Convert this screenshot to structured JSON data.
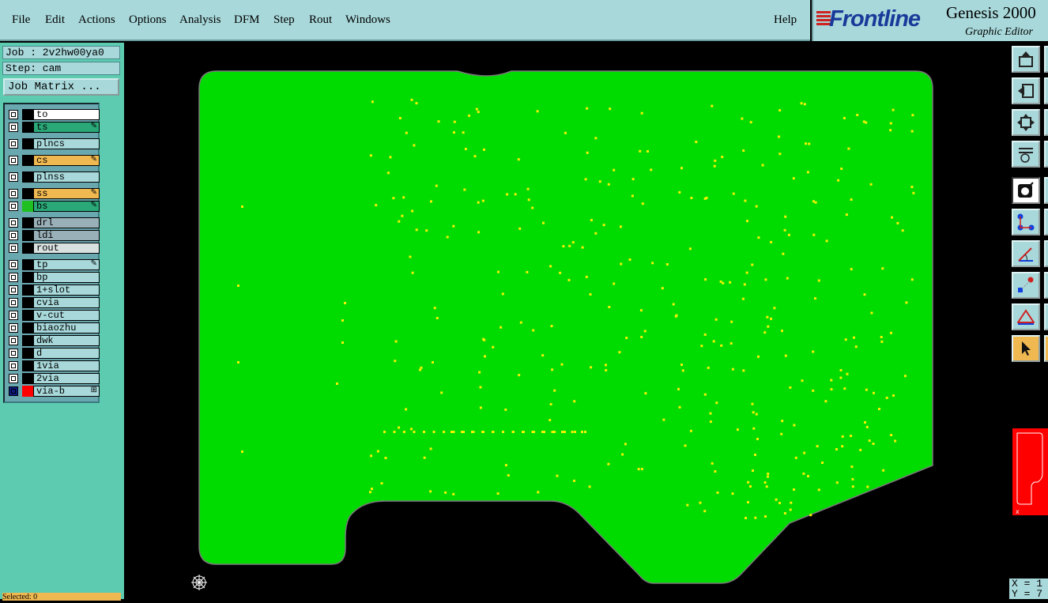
{
  "menubar": {
    "items": [
      "File",
      "Edit",
      "Actions",
      "Options",
      "Analysis",
      "DFM",
      "Step",
      "Rout",
      "Windows"
    ],
    "help": "Help"
  },
  "brand": {
    "logo_text": "Frontline",
    "product": "Genesis 2000",
    "subtitle": "Graphic Editor"
  },
  "job": {
    "job_line": "Job : 2v2hw00ya0",
    "step_line": "Step: cam",
    "matrix_button": "Job Matrix ..."
  },
  "layers": [
    {
      "name": "to",
      "color": "#ffffff"
    },
    {
      "name": "ts",
      "color": "#2aa878",
      "flag": true
    },
    {
      "name": "plncs",
      "color": "#a8d8da"
    },
    {
      "name": "cs",
      "color": "#f0b850",
      "flag": true
    },
    {
      "name": "plnss",
      "color": "#a8d8da"
    },
    {
      "name": "ss",
      "color": "#f0b850",
      "flag": true
    },
    {
      "name": "bs",
      "color": "#2aa878",
      "flag": true,
      "swatch": "#20c020"
    },
    {
      "name": "drl",
      "color": "#9ab0b8"
    },
    {
      "name": "ldi",
      "color": "#9ab0b8"
    },
    {
      "name": "rout",
      "color": "#d8e0e0"
    },
    {
      "name": "tp",
      "color": "#a8d8da",
      "flag": true
    },
    {
      "name": "bp",
      "color": "#a8d8da"
    },
    {
      "name": "1+slot",
      "color": "#a8d8da"
    },
    {
      "name": "cvia",
      "color": "#a8d8da"
    },
    {
      "name": "v-cut",
      "color": "#a8d8da"
    },
    {
      "name": "biaozhu",
      "color": "#a8d8da"
    },
    {
      "name": "dwk",
      "color": "#a8d8da"
    },
    {
      "name": "d",
      "color": "#a8d8da"
    },
    {
      "name": "1via",
      "color": "#a8d8da"
    },
    {
      "name": "2via",
      "color": "#a8d8da"
    },
    {
      "name": "via-b",
      "color": "#a8d8da",
      "swatch": "#ff0000",
      "active": true
    }
  ],
  "bottom_status": "Selected: 0",
  "coords": {
    "x": "X = 1",
    "y": "Y = 7"
  },
  "colors": {
    "board_fill": "#00dc00",
    "via_dots": "#f2f200",
    "panel_bg": "#5ccbb0",
    "menu_bg": "#a8d8da"
  },
  "icons": [
    "zoom-home-icon",
    "zoom-back-icon",
    "fit-screen-icon",
    "settings-palette-icon",
    "snap-icon",
    "connect-icon",
    "measure-icon",
    "features-icon",
    "triangle-icon",
    "pointer-icon"
  ]
}
